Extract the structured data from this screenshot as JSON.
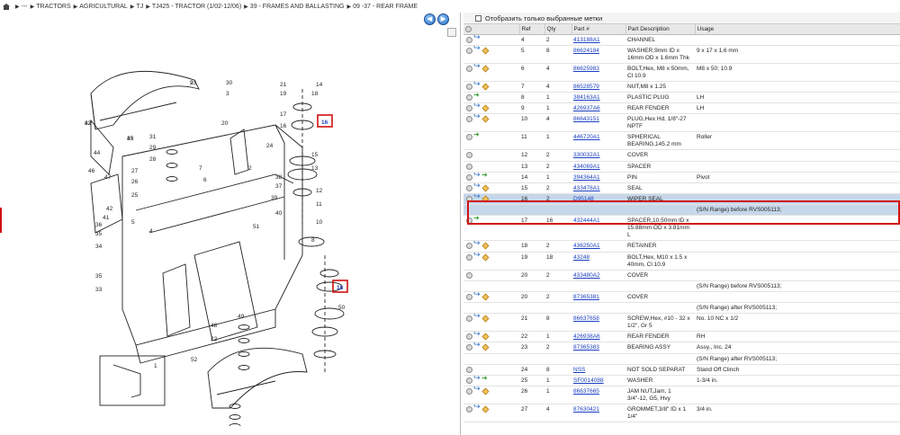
{
  "breadcrumb": {
    "items": [
      "---",
      "TRACTORS",
      "AGRICULTURAL",
      "TJ",
      "TJ425 - TRACTOR (1/02-12/06)",
      "39 - FRAMES AND BALLASTING",
      "09 -37 - REAR FRAME"
    ]
  },
  "filter": {
    "label": "Отобразить только выбранные метки"
  },
  "table": {
    "columns": [
      "Ref",
      "Qty",
      "Part #",
      "Part Description",
      "Usage"
    ],
    "rows": [
      {
        "ref": "4",
        "qty": "2",
        "part": "413188A1",
        "desc": "CHANNEL",
        "usage": "",
        "icons": [
          "cir",
          "ret"
        ]
      },
      {
        "ref": "5",
        "qty": "8",
        "part": "86624184",
        "desc": "WASHER,9mm ID x 16mm OD x 1.6mm Thk",
        "usage": "9 x 17 x 1,6 mm",
        "icons": [
          "cir",
          "ret",
          "box"
        ]
      },
      {
        "ref": "6",
        "qty": "4",
        "part": "86625983",
        "desc": "BOLT,Hex, M8 x 50mm, Cl 10.9",
        "usage": "M8 x 50; 10.9",
        "icons": [
          "cir",
          "ret",
          "box"
        ]
      },
      {
        "ref": "7",
        "qty": "4",
        "part": "86528579",
        "desc": "NUT,M8 x 1.25",
        "usage": "",
        "icons": [
          "cir",
          "ret",
          "box"
        ]
      },
      {
        "ref": "8",
        "qty": "1",
        "part": "384163A1",
        "desc": "PLASTIC PLUG",
        "usage": "LH",
        "icons": [
          "cir",
          "grn"
        ]
      },
      {
        "ref": "9",
        "qty": "1",
        "part": "426937A6",
        "desc": "REAR FENDER",
        "usage": "LH",
        "icons": [
          "cir",
          "ret",
          "box"
        ]
      },
      {
        "ref": "10",
        "qty": "4",
        "part": "86643151",
        "desc": "PLUG,Hex Hd, 1/8\"-27 NPTF",
        "usage": "",
        "icons": [
          "cir",
          "ret",
          "box"
        ]
      },
      {
        "ref": "11",
        "qty": "1",
        "part": "446720A1",
        "desc": "SPHERICAL BEARING,145.2 mm",
        "usage": "Roller",
        "icons": [
          "cir",
          "grn"
        ]
      },
      {
        "ref": "12",
        "qty": "2",
        "part": "330032A1",
        "desc": "COVER",
        "usage": "",
        "icons": [
          "cir"
        ]
      },
      {
        "ref": "13",
        "qty": "2",
        "part": "434069A1",
        "desc": "SPACER",
        "usage": "",
        "icons": [
          "cir"
        ]
      },
      {
        "ref": "14",
        "qty": "1",
        "part": "394364A1",
        "desc": "PIN",
        "usage": "Pivot",
        "icons": [
          "cir",
          "ret",
          "grn"
        ]
      },
      {
        "ref": "15",
        "qty": "2",
        "part": "433478A1",
        "desc": "SEAL",
        "usage": "",
        "icons": [
          "cir",
          "ret",
          "box"
        ]
      },
      {
        "ref": "16",
        "qty": "2",
        "part": "D95148",
        "desc": "WIPER SEAL",
        "usage": "",
        "icons": [
          "cir",
          "ret",
          "box"
        ],
        "selected": true,
        "sub": "(S/N Range) before RVS005113;"
      },
      {
        "ref": "17",
        "qty": "16",
        "part": "432444A1",
        "desc": "SPACER,10.50mm ID x 15.88mm OD x 3.81mm L",
        "usage": "",
        "icons": [
          "cir",
          "grn"
        ]
      },
      {
        "ref": "18",
        "qty": "2",
        "part": "436250A1",
        "desc": "RETAINER",
        "usage": "",
        "icons": [
          "cir",
          "ret",
          "box"
        ]
      },
      {
        "ref": "19",
        "qty": "18",
        "part": "43248",
        "desc": "BOLT,Hex, M10 x 1.5 x 40mm, Cl 10.9",
        "usage": "",
        "icons": [
          "cir",
          "ret",
          "box"
        ]
      },
      {
        "ref": "20",
        "qty": "2",
        "part": "433480A2",
        "desc": "COVER",
        "usage": "",
        "icons": [
          "cir"
        ],
        "sub": "(S/N Range) before RVS005113;"
      },
      {
        "ref": "20",
        "qty": "2",
        "part": "87365381",
        "desc": "COVER",
        "usage": "",
        "icons": [
          "cir",
          "ret",
          "box"
        ],
        "sub": "(S/N Range) after RVS005113;"
      },
      {
        "ref": "21",
        "qty": "8",
        "part": "86637658",
        "desc": "SCREW,Hex, #10 - 32 x 1/2\", Gr 5",
        "usage": "No. 10 NC x 1/2",
        "icons": [
          "cir",
          "ret",
          "box"
        ]
      },
      {
        "ref": "22",
        "qty": "1",
        "part": "426938A6",
        "desc": "REAR FENDER",
        "usage": "RH",
        "icons": [
          "cir",
          "ret",
          "box"
        ]
      },
      {
        "ref": "23",
        "qty": "2",
        "part": "87365383",
        "desc": "BEARING ASSY",
        "usage": "Assy., Inc. 24",
        "icons": [
          "cir",
          "ret",
          "box"
        ],
        "sub": "(S/N Range) after RVS005113;"
      },
      {
        "ref": "24",
        "qty": "8",
        "part": "NSS",
        "desc": "NOT SOLD SEPARAT",
        "usage": "Stand Off Clinch",
        "icons": [
          "cir"
        ]
      },
      {
        "ref": "25",
        "qty": "1",
        "part": "SF0014088",
        "desc": "WASHER",
        "usage": "1-3/4 in.",
        "icons": [
          "cir",
          "ret",
          "grn"
        ]
      },
      {
        "ref": "26",
        "qty": "1",
        "part": "86637665",
        "desc": "JAM NUT,Jam, 1 3/4\"-12, G5, Hvy",
        "usage": "",
        "icons": [
          "cir",
          "ret",
          "box"
        ]
      },
      {
        "ref": "27",
        "qty": "4",
        "part": "87630421",
        "desc": "GROMMET,3/8\" ID x 1 1/4\"",
        "usage": "3/4 in.",
        "icons": [
          "cir",
          "ret",
          "box"
        ]
      }
    ]
  },
  "diagram": {
    "callouts": [
      "9",
      "43",
      "45",
      "44",
      "46",
      "47",
      "42",
      "41",
      "36",
      "35",
      "34",
      "35",
      "33",
      "31",
      "29",
      "28",
      "27",
      "26",
      "25",
      "1",
      "30",
      "3",
      "20",
      "21",
      "19",
      "17",
      "16",
      "24",
      "15",
      "14",
      "18",
      "13",
      "12",
      "11",
      "10",
      "8",
      "7",
      "6",
      "5",
      "4",
      "2",
      "37",
      "38",
      "39",
      "40",
      "51",
      "52",
      "50",
      "49",
      "48",
      "22",
      "23",
      "32",
      "33"
    ],
    "highlight_labels": [
      "16",
      "16"
    ]
  }
}
